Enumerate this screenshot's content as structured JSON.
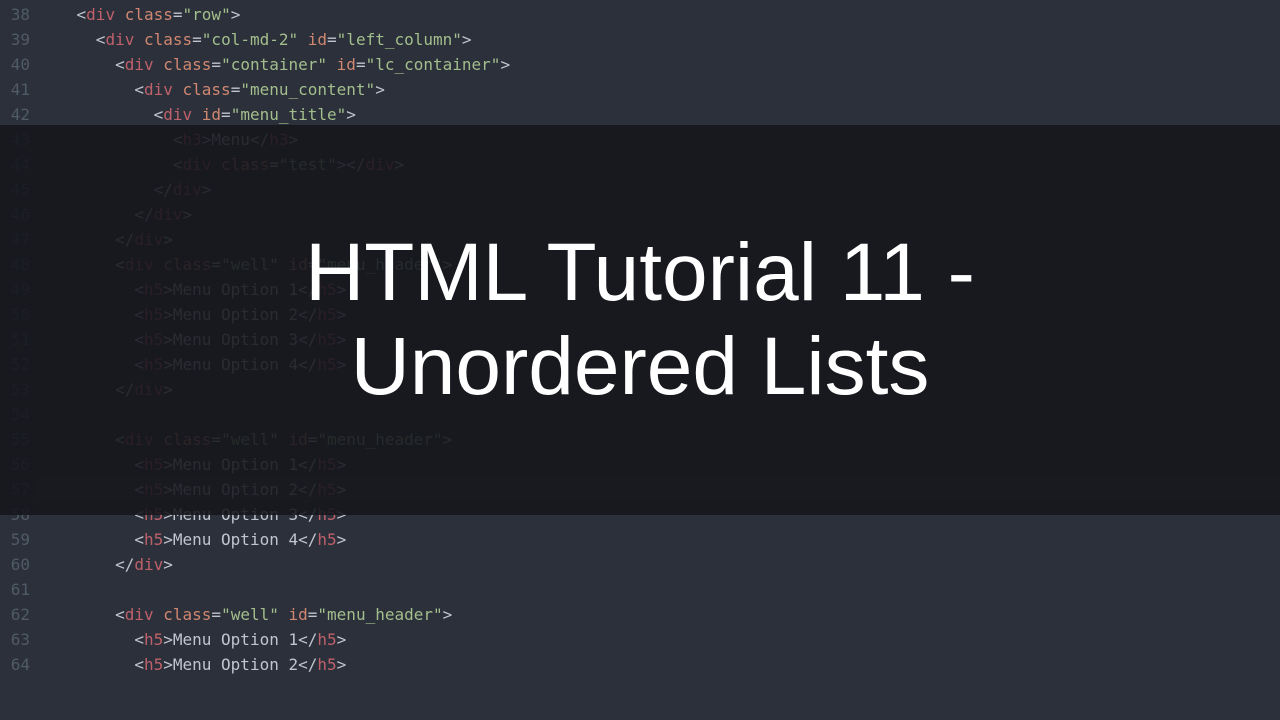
{
  "overlay": {
    "line1": "HTML Tutorial 11 -",
    "line2": "Unordered Lists"
  },
  "gutter_start": 38,
  "code_lines": [
    {
      "indent": 2,
      "kind": "open",
      "tag": "div",
      "attrs": [
        [
          "class",
          "row"
        ]
      ]
    },
    {
      "indent": 3,
      "kind": "open",
      "tag": "div",
      "attrs": [
        [
          "class",
          "col-md-2"
        ],
        [
          "id",
          "left_column"
        ]
      ]
    },
    {
      "indent": 4,
      "kind": "open",
      "tag": "div",
      "attrs": [
        [
          "class",
          "container"
        ],
        [
          "id",
          "lc_container"
        ]
      ]
    },
    {
      "indent": 5,
      "kind": "open",
      "tag": "div",
      "attrs": [
        [
          "class",
          "menu_content"
        ]
      ]
    },
    {
      "indent": 6,
      "kind": "open",
      "tag": "div",
      "attrs": [
        [
          "id",
          "menu_title"
        ]
      ]
    },
    {
      "indent": 7,
      "kind": "inline",
      "tag": "h3",
      "text": "Menu"
    },
    {
      "indent": 7,
      "kind": "empty",
      "tag": "div",
      "attrs": [
        [
          "class",
          "test"
        ]
      ]
    },
    {
      "indent": 6,
      "kind": "close",
      "tag": "div"
    },
    {
      "indent": 5,
      "kind": "close",
      "tag": "div"
    },
    {
      "indent": 4,
      "kind": "close",
      "tag": "div"
    },
    {
      "indent": 4,
      "kind": "open",
      "tag": "div",
      "attrs": [
        [
          "class",
          "well"
        ],
        [
          "id",
          "menu_header"
        ]
      ]
    },
    {
      "indent": 5,
      "kind": "inline",
      "tag": "h5",
      "text": "Menu Option 1"
    },
    {
      "indent": 5,
      "kind": "inline",
      "tag": "h5",
      "text": "Menu Option 2"
    },
    {
      "indent": 5,
      "kind": "inline",
      "tag": "h5",
      "text": "Menu Option 3"
    },
    {
      "indent": 5,
      "kind": "inline",
      "tag": "h5",
      "text": "Menu Option 4"
    },
    {
      "indent": 4,
      "kind": "close",
      "tag": "div"
    },
    {
      "indent": 0,
      "kind": "blank"
    },
    {
      "indent": 4,
      "kind": "open",
      "tag": "div",
      "attrs": [
        [
          "class",
          "well"
        ],
        [
          "id",
          "menu_header"
        ]
      ]
    },
    {
      "indent": 5,
      "kind": "inline",
      "tag": "h5",
      "text": "Menu Option 1"
    },
    {
      "indent": 5,
      "kind": "inline",
      "tag": "h5",
      "text": "Menu Option 2",
      "hl": true
    },
    {
      "indent": 5,
      "kind": "inline",
      "tag": "h5",
      "text": "Menu Option 3"
    },
    {
      "indent": 5,
      "kind": "inline",
      "tag": "h5",
      "text": "Menu Option 4"
    },
    {
      "indent": 4,
      "kind": "close",
      "tag": "div"
    },
    {
      "indent": 0,
      "kind": "blank"
    },
    {
      "indent": 4,
      "kind": "open",
      "tag": "div",
      "attrs": [
        [
          "class",
          "well"
        ],
        [
          "id",
          "menu_header"
        ]
      ]
    },
    {
      "indent": 5,
      "kind": "inline",
      "tag": "h5",
      "text": "Menu Option 1"
    },
    {
      "indent": 5,
      "kind": "inline",
      "tag": "h5",
      "text": "Menu Option 2"
    }
  ]
}
